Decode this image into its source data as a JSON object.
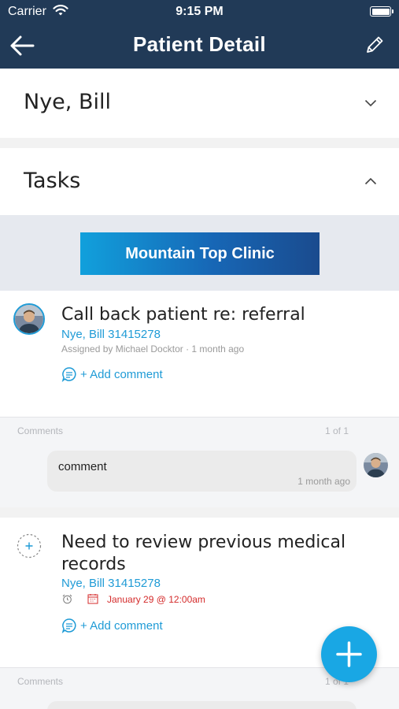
{
  "status_bar": {
    "carrier": "Carrier",
    "time": "9:15 PM"
  },
  "nav": {
    "title": "Patient Detail",
    "back_icon": "arrow-left-icon",
    "edit_icon": "pencil-icon"
  },
  "patient_section": {
    "name": "Nye, Bill",
    "expanded": false
  },
  "tasks_section": {
    "title": "Tasks",
    "expanded": true
  },
  "clinic": {
    "label": "Mountain Top Clinic"
  },
  "tasks": [
    {
      "title": "Call back patient re: referral",
      "patient": "Nye, Bill 31415278",
      "meta": "Assigned by Michael Docktor · 1 month ago",
      "add_comment": "+ Add comment",
      "comments": {
        "label": "Comments",
        "count": "1 of 1",
        "items": [
          {
            "text": "comment",
            "time": "1 month ago"
          }
        ]
      }
    },
    {
      "title_line1": "Need to review previous medical",
      "title_line2": "records",
      "patient": "Nye, Bill 31415278",
      "due": "January 29 @ 12:00am",
      "add_comment": "+ Add comment",
      "comments": {
        "label": "Comments",
        "count": "1 of 1"
      }
    }
  ],
  "colors": {
    "header": "#213a57",
    "accent": "#1f9bd6",
    "due_red": "#d42b2b",
    "fab": "#19a7e4"
  }
}
